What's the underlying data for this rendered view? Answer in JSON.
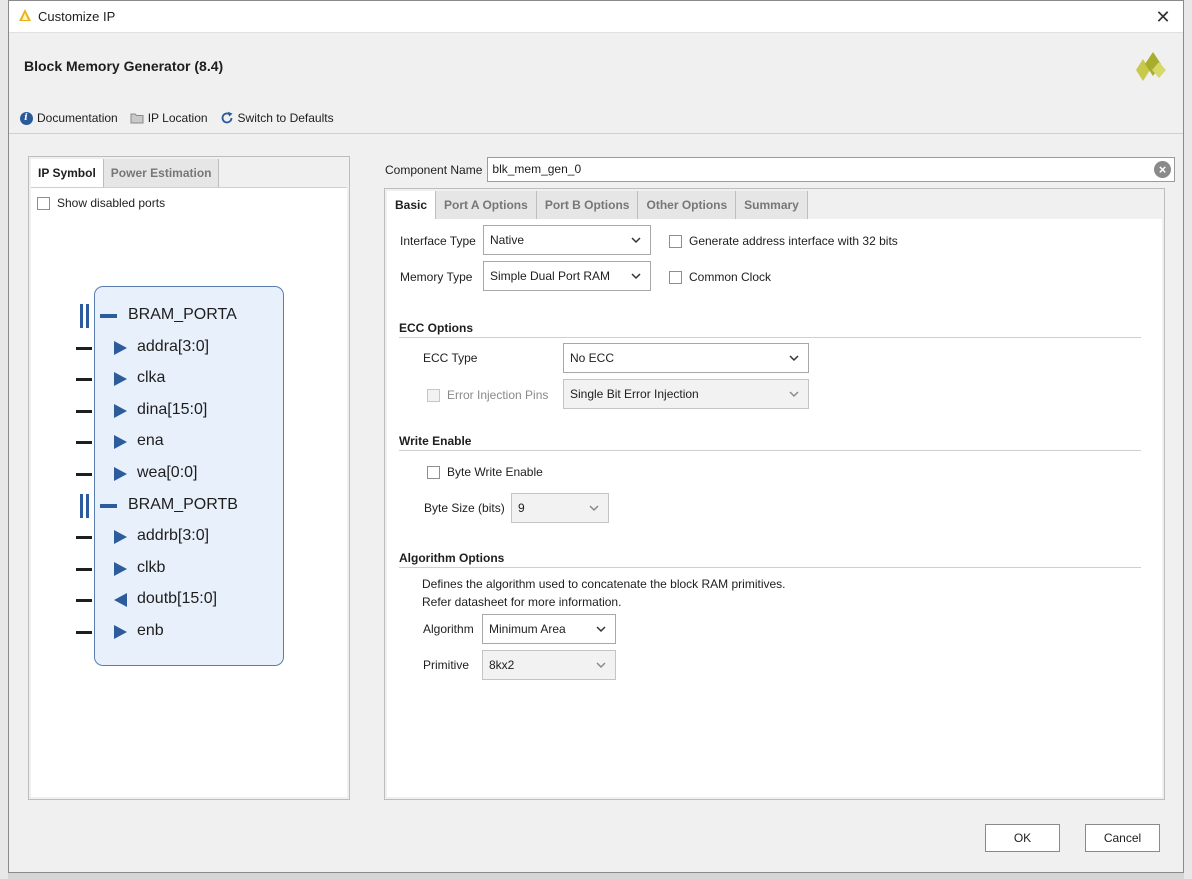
{
  "window": {
    "title": "Customize IP",
    "close": "✕"
  },
  "header": {
    "ip_name": "Block Memory Generator (8.4)"
  },
  "toolbar": {
    "documentation": "Documentation",
    "ip_location": "IP Location",
    "switch_defaults": "Switch to Defaults"
  },
  "left_tabs": [
    "IP Symbol",
    "Power Estimation"
  ],
  "show_disabled_ports": "Show disabled ports",
  "symbol": {
    "bus_a": "BRAM_PORTA",
    "ports_a": [
      "addra[3:0]",
      "clka",
      "dina[15:0]",
      "ena",
      "wea[0:0]"
    ],
    "bus_b": "BRAM_PORTB",
    "ports_b": [
      "addrb[3:0]",
      "clkb",
      "doutb[15:0]",
      "enb"
    ]
  },
  "component": {
    "label": "Component Name",
    "value": "blk_mem_gen_0"
  },
  "right_tabs": [
    "Basic",
    "Port A Options",
    "Port B Options",
    "Other Options",
    "Summary"
  ],
  "basic": {
    "interface_type_label": "Interface Type",
    "interface_type_value": "Native",
    "memory_type_label": "Memory Type",
    "memory_type_value": "Simple Dual Port RAM",
    "gen_addr_32": "Generate address interface with 32 bits",
    "common_clock": "Common Clock",
    "ecc_section": "ECC Options",
    "ecc_type_label": "ECC Type",
    "ecc_type_value": "No ECC",
    "error_injection_label": "Error Injection Pins",
    "error_injection_value": "Single Bit Error Injection",
    "write_enable_section": "Write Enable",
    "byte_write_enable": "Byte Write Enable",
    "byte_size_label": "Byte Size (bits)",
    "byte_size_value": "9",
    "algorithm_section": "Algorithm Options",
    "algorithm_desc1": "Defines the algorithm used to concatenate the block RAM primitives.",
    "algorithm_desc2": "Refer datasheet for more information.",
    "algorithm_label": "Algorithm",
    "algorithm_value": "Minimum Area",
    "primitive_label": "Primitive",
    "primitive_value": "8kx2"
  },
  "buttons": {
    "ok": "OK",
    "cancel": "Cancel"
  }
}
